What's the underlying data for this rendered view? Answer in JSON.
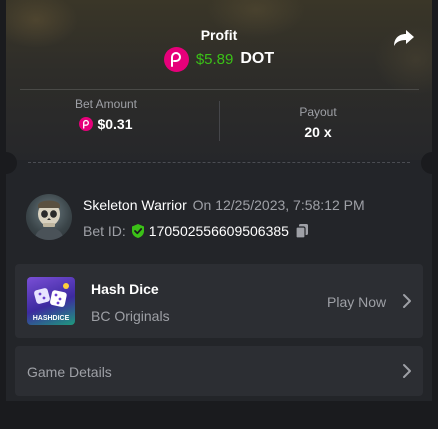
{
  "header": {
    "profit_label": "Profit",
    "profit_amount": "$5.89",
    "profit_currency": "DOT",
    "coin_icon": "polkadot-coin-icon",
    "share_icon": "share-arrow-icon"
  },
  "stats": {
    "bet_amount_label": "Bet Amount",
    "bet_amount_value": "$0.31",
    "payout_label": "Payout",
    "payout_value": "20 x"
  },
  "user": {
    "name": "Skeleton Warrior",
    "date": "On 12/25/2023, 7:58:12 PM",
    "bet_id_label": "Bet ID:",
    "bet_id_value": "170502556609506385",
    "verified_icon": "shield-check-icon",
    "copy_icon": "copy-icon"
  },
  "game": {
    "title": "Hash Dice",
    "subtitle": "BC Originals",
    "thumb_text": "HASHDICE",
    "play_label": "Play Now"
  },
  "details": {
    "label": "Game Details"
  },
  "colors": {
    "accent_green": "#3bc117",
    "polkadot_pink": "#e6007a",
    "background": "#1a1b1e",
    "card": "#232529",
    "panel": "#2c2e33",
    "muted_text": "#9ea0a6"
  }
}
